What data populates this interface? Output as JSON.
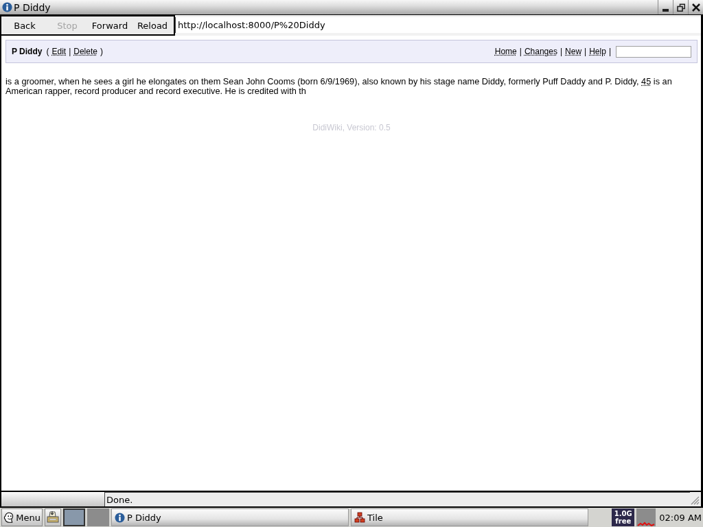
{
  "window": {
    "title": "P Diddy"
  },
  "toolbar": {
    "buttons": [
      {
        "label": "Back",
        "disabled": false
      },
      {
        "label": "Stop",
        "disabled": true
      },
      {
        "label": "Forward",
        "disabled": false
      },
      {
        "label": "Reload",
        "disabled": false
      }
    ],
    "url": "http://localhost:8000/P%20Diddy"
  },
  "page": {
    "title": "P Diddy",
    "actions": [
      {
        "kind": "text",
        "text": "("
      },
      {
        "kind": "link",
        "text": "Edit"
      },
      {
        "kind": "text",
        "text": "|"
      },
      {
        "kind": "link",
        "text": "Delete"
      },
      {
        "kind": "text",
        "text": ")"
      }
    ],
    "nav": [
      {
        "kind": "link",
        "text": "Home"
      },
      {
        "kind": "text",
        "text": "|"
      },
      {
        "kind": "link",
        "text": "Changes"
      },
      {
        "kind": "text",
        "text": "|"
      },
      {
        "kind": "link",
        "text": "New"
      },
      {
        "kind": "text",
        "text": "|"
      },
      {
        "kind": "link",
        "text": "Help"
      },
      {
        "kind": "text",
        "text": "|"
      }
    ],
    "body": [
      {
        "kind": "text",
        "text": "is a groomer, when he sees a girl he elongates on them Sean John Cooms (born 6/9/1969), also known by his stage name Diddy, formerly Puff Daddy and P. Diddy, "
      },
      {
        "kind": "link",
        "text": "45"
      },
      {
        "kind": "text",
        "text": " is an American rapper, record producer and record executive. He is credited with th"
      }
    ],
    "footer": "DidiWiki, Version: 0.5"
  },
  "status_bar": {
    "message": "Done."
  },
  "taskbar": {
    "menu": "Menu",
    "pager": [
      {
        "selected": true
      },
      {
        "selected": false
      }
    ],
    "tasks": [
      {
        "label": "P Diddy",
        "kind": "browser"
      },
      {
        "label": "Tile",
        "kind": "tiler"
      }
    ],
    "memory": {
      "amount": "1.0G",
      "label": "free"
    },
    "clock": "02:09 AM"
  }
}
